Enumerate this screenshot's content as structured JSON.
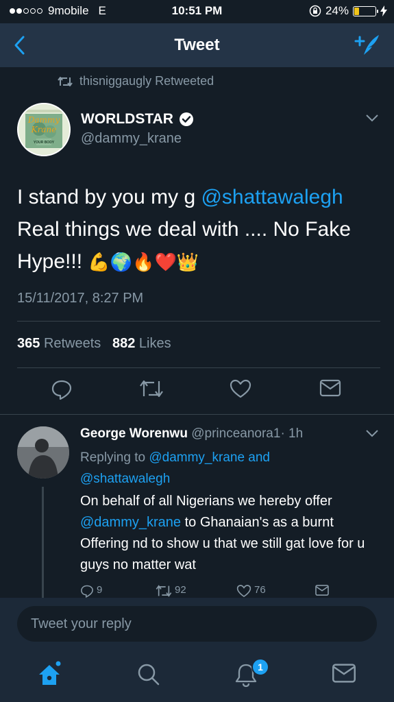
{
  "status_bar": {
    "carrier": "9mobile",
    "network": "E",
    "time": "10:51 PM",
    "battery": "24%",
    "battery_level": 0.24
  },
  "nav": {
    "title": "Tweet"
  },
  "retweet_line": {
    "text": "thisniggaugly Retweeted"
  },
  "tweet": {
    "name": "WORLDSTAR",
    "handle": "@dammy_krane",
    "avatar_text": "Dammy Krane",
    "avatar_sub": "YOUR BODY",
    "text_part1": "I stand by you my g ",
    "mention": "@shattawalegh",
    "text_part2": " Real things we deal with .... No Fake Hype!!! ",
    "emojis": "💪🌍🔥❤️👑",
    "date": "15/11/2017, 8:27 PM",
    "retweets_count": "365",
    "retweets_label": "Retweets",
    "likes_count": "882",
    "likes_label": "Likes"
  },
  "reply": {
    "name": "George Worenwu",
    "handle": "@princeanora1",
    "time": "· 1h",
    "replying_prefix": "Replying to",
    "replying_user1": "@dammy_krane",
    "replying_and": "and",
    "replying_user2": "@shattawalegh",
    "text_part1": "On behalf of all Nigerians we hereby offer ",
    "text_mention": "@dammy_krane",
    "text_part2": "  to Ghanaian's as a burnt Offering nd to show u that we still gat love for u guys no matter wat",
    "reply_count": "9",
    "retweet_count": "92",
    "like_count": "76"
  },
  "composer": {
    "placeholder": "Tweet your reply"
  },
  "tabbar": {
    "notification_badge": "1"
  },
  "colors": {
    "background": "#141d26",
    "bar": "#243447",
    "accent": "#1da1f2",
    "muted": "#8899a6"
  }
}
